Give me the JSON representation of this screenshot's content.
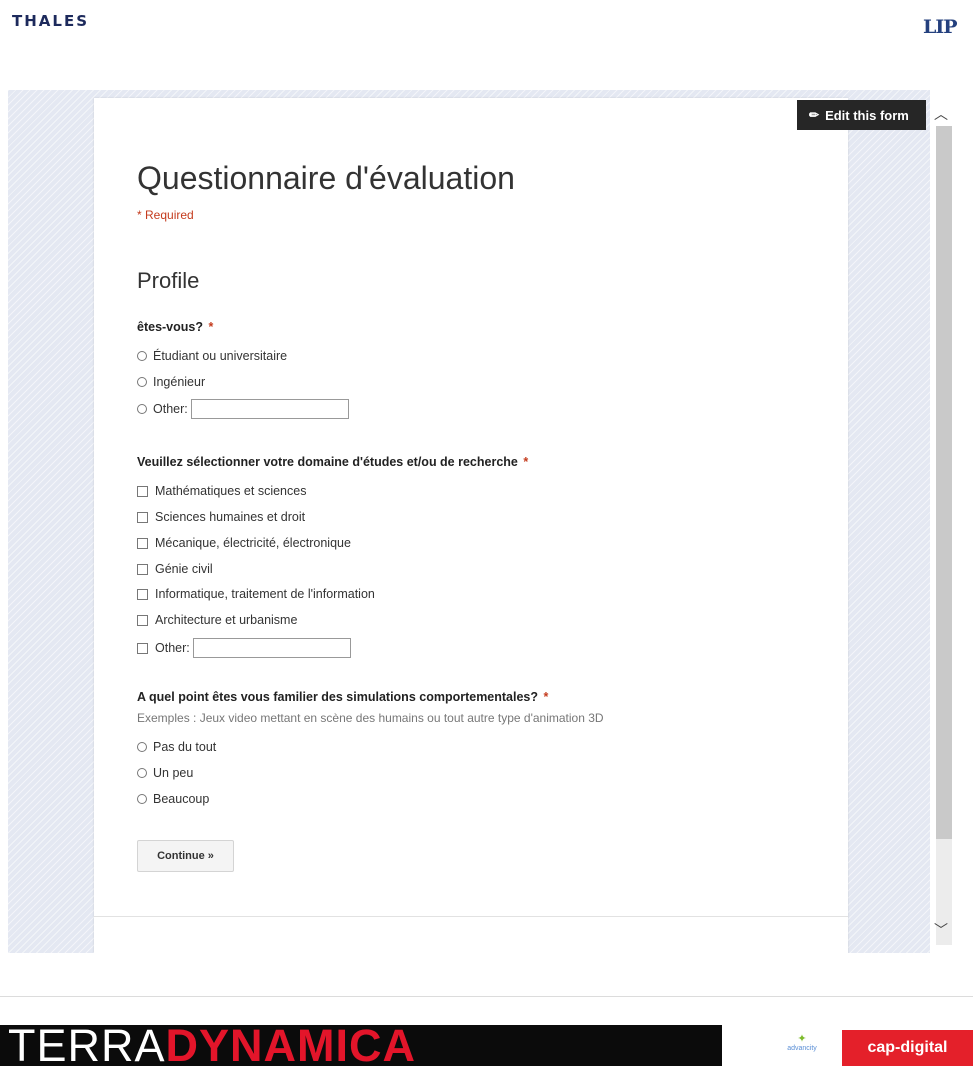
{
  "header": {
    "left_logo": "THALES",
    "right_logo": "LIP"
  },
  "edit_form_label": "Edit this form",
  "form": {
    "title": "Questionnaire d'évaluation",
    "required_note": "* Required",
    "section_title": "Profile",
    "questions": [
      {
        "label": "êtes-vous?",
        "required_mark": "*",
        "options": [
          "Étudiant ou universitaire",
          "Ingénieur",
          "Other:"
        ]
      },
      {
        "label": "Veuillez sélectionner votre domaine d'études et/ou de recherche",
        "required_mark": "*",
        "options": [
          "Mathématiques et sciences",
          "Sciences humaines et droit",
          "Mécanique, électricité, électronique",
          "Génie civil",
          "Informatique, traitement de l'information",
          "Architecture et urbanisme",
          "Other:"
        ]
      },
      {
        "label": "A quel point êtes vous familier des simulations comportementales?",
        "required_mark": "*",
        "help": "Exemples : Jeux video mettant en scène des humains ou tout autre type d'animation 3D",
        "options": [
          "Pas du tout",
          "Un peu",
          "Beaucoup"
        ]
      }
    ],
    "continue_label": "Continue »"
  },
  "footer": {
    "banner_part1": "TERRA",
    "banner_part2": "DYNAMICA",
    "partner_1": "advancity",
    "partner_2": "cap-digital"
  },
  "colors": {
    "required_red": "#c43b1d",
    "edit_button_bg": "#262626",
    "banner_red": "#e3152a",
    "cap_digital_red": "#e4202a"
  },
  "icons": [
    "pencil-icon",
    "chevron-up-icon",
    "chevron-down-icon",
    "radio-icon",
    "checkbox-icon"
  ]
}
